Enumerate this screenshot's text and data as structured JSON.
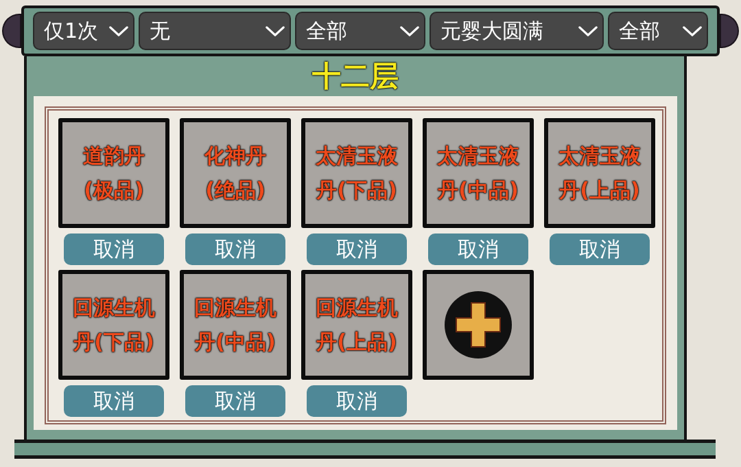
{
  "filters": [
    {
      "value": "仅1次"
    },
    {
      "value": "无"
    },
    {
      "value": "全部"
    },
    {
      "value": "元婴大圆满"
    },
    {
      "value": "全部"
    }
  ],
  "floor_title": "十二层",
  "slots": [
    {
      "kind": "item",
      "name": "道韵丹(极品)",
      "button": "取消"
    },
    {
      "kind": "item",
      "name": "化神丹(绝品)",
      "button": "取消"
    },
    {
      "kind": "item",
      "name": "太清玉液丹(下品)",
      "button": "取消"
    },
    {
      "kind": "item",
      "name": "太清玉液丹(中品)",
      "button": "取消"
    },
    {
      "kind": "item",
      "name": "太清玉液丹(上品)",
      "button": "取消"
    },
    {
      "kind": "item",
      "name": "回源生机丹(下品)",
      "button": "取消"
    },
    {
      "kind": "item",
      "name": "回源生机丹(中品)",
      "button": "取消"
    },
    {
      "kind": "item",
      "name": "回源生机丹(上品)",
      "button": "取消"
    },
    {
      "kind": "add"
    }
  ]
}
